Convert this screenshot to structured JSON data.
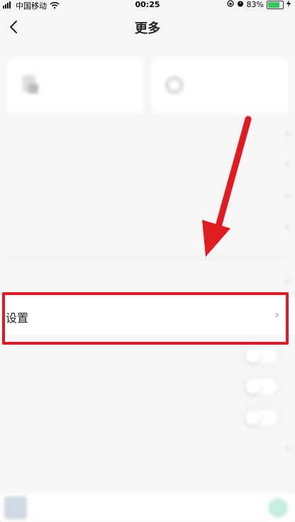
{
  "status": {
    "carrier": "中国移动",
    "time": "00:25",
    "battery": "83%",
    "battery_level": 0.83
  },
  "navbar": {
    "title": "更多"
  },
  "settings_row": {
    "label": "设置"
  },
  "colors": {
    "highlight": "#e11b22",
    "accent": "#34c759"
  },
  "icons": {
    "back": "chevron-left-icon",
    "chevron": "chevron-right-icon"
  }
}
